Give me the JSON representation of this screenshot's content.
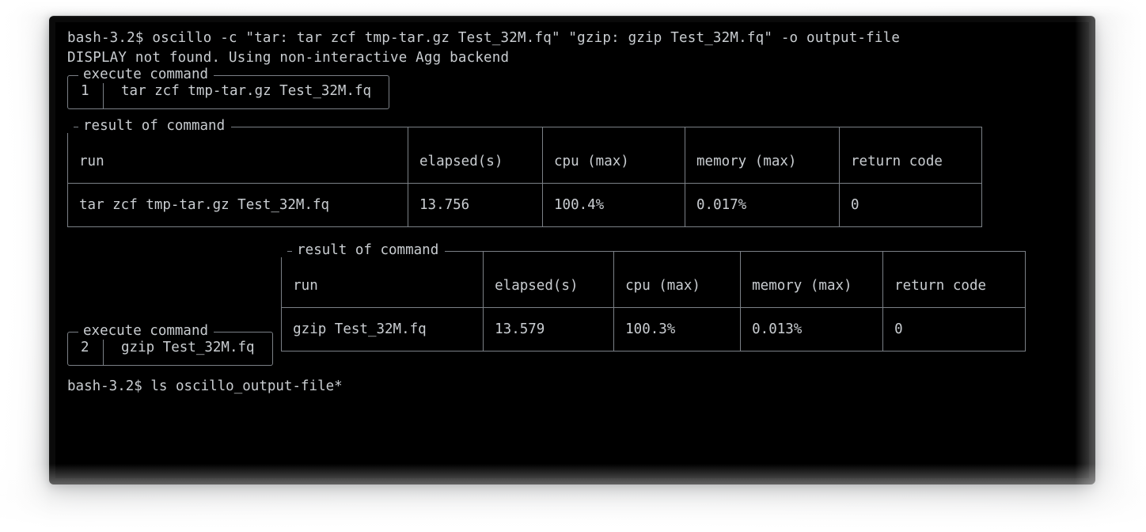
{
  "terminal": {
    "prompt_line": "bash-3.2$ oscillo -c \"tar: tar zcf tmp-tar.gz Test_32M.fq\" \"gzip: gzip Test_32M.fq\" -o output-file",
    "display_warning": "DISPLAY not found. Using non-interactive Agg backend",
    "tail_line": "bash-3.2$ ls oscillo_output-file*",
    "colors": {
      "background": "#000000",
      "foreground": "#c9cdd1",
      "border": "#7b8086",
      "page_background": "#ffffff"
    }
  },
  "blocks": [
    {
      "panel_title": "execute command",
      "index": "1",
      "command": "tar zcf tmp-tar.gz Test_32M.fq"
    },
    {
      "panel_title": "execute command",
      "index": "2",
      "command": "gzip Test_32M.fq"
    }
  ],
  "results": [
    {
      "title": "result of command",
      "headers": [
        "run",
        "elapsed(s)",
        "cpu (max)",
        "memory (max)",
        "return code"
      ],
      "rows": [
        [
          "tar zcf tmp-tar.gz Test_32M.fq",
          "13.756",
          "100.4%",
          "0.017%",
          "0"
        ]
      ],
      "col_widths": [
        "430px",
        "170px",
        "180px",
        "195px",
        "180px"
      ]
    },
    {
      "title": "result of command",
      "headers": [
        "run",
        "elapsed(s)",
        "cpu (max)",
        "memory (max)",
        "return code"
      ],
      "rows": [
        [
          "gzip Test_32M.fq",
          "13.579",
          "100.3%",
          "0.013%",
          "0"
        ]
      ],
      "col_widths": [
        "255px",
        "165px",
        "160px",
        "180px",
        "180px"
      ]
    }
  ]
}
